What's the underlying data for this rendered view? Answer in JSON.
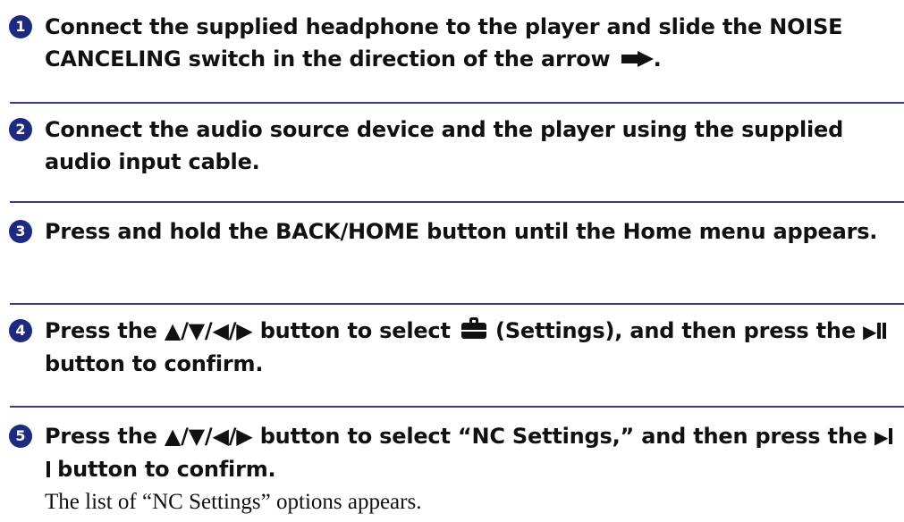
{
  "steps": [
    {
      "number": "1",
      "text_a": "Connect the supplied headphone to the player and slide the NOISE CANCELING switch in the direction of the arrow",
      "arrow_icon": "right-arrow",
      "text_b": "."
    },
    {
      "number": "2",
      "text": "Connect the audio source device and the player using the supplied audio input cable."
    },
    {
      "number": "3",
      "text": "Press and hold the BACK/HOME button until the Home menu appears."
    },
    {
      "number": "4",
      "text_a": "Press the ▲/▼/◀/▶ button to select",
      "settings_icon": "suitcase-settings-icon",
      "text_b": "(Settings), and then press the",
      "play_pause_icon": "play-pause-icon",
      "text_c": "button to confirm."
    },
    {
      "number": "5",
      "text_a": "Press the ▲/▼/◀/▶ button to select “NC Settings,” and then press the",
      "play_pause_icon": "play-pause-icon",
      "text_c": "button to confirm."
    }
  ],
  "result_text": "The list of “NC Settings” options appears.",
  "colors": {
    "accent": "#1e2a80",
    "separator": "#3a3a8c",
    "text": "#111111"
  }
}
